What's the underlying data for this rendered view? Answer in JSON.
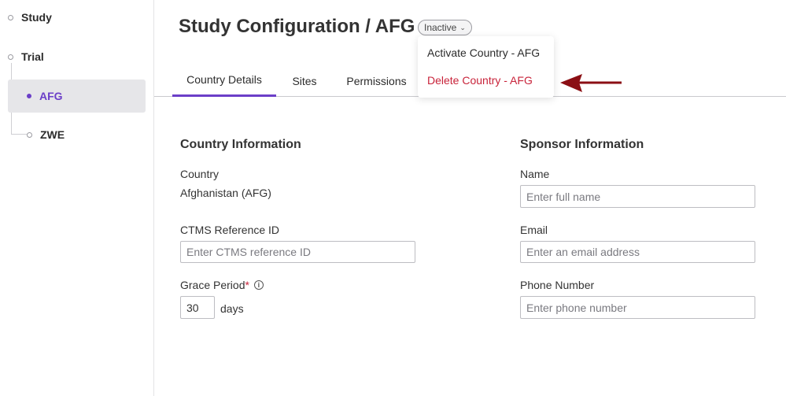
{
  "sidebar": {
    "items": [
      {
        "label": "Study"
      },
      {
        "label": "Trial"
      },
      {
        "label": "AFG"
      },
      {
        "label": "ZWE"
      }
    ]
  },
  "header": {
    "title": "Study Configuration / AFG",
    "status": "Inactive"
  },
  "tabs": [
    {
      "label": "Country Details",
      "active": true
    },
    {
      "label": "Sites"
    },
    {
      "label": "Permissions"
    }
  ],
  "dropdown": {
    "activate_label": "Activate Country - AFG",
    "delete_label": "Delete Country - AFG"
  },
  "country_info": {
    "title": "Country Information",
    "country_label": "Country",
    "country_value": "Afghanistan (AFG)",
    "ctms_label": "CTMS Reference ID",
    "ctms_placeholder": "Enter CTMS reference ID",
    "grace_label": "Grace Period",
    "grace_required": "*",
    "grace_value": "30",
    "grace_unit": "days"
  },
  "sponsor_info": {
    "title": "Sponsor Information",
    "name_label": "Name",
    "name_placeholder": "Enter full name",
    "email_label": "Email",
    "email_placeholder": "Enter an email address",
    "phone_label": "Phone Number",
    "phone_placeholder": "Enter phone number"
  },
  "colors": {
    "accent": "#6b3fc8",
    "danger": "#c8233a",
    "arrow": "#8b0f14"
  }
}
